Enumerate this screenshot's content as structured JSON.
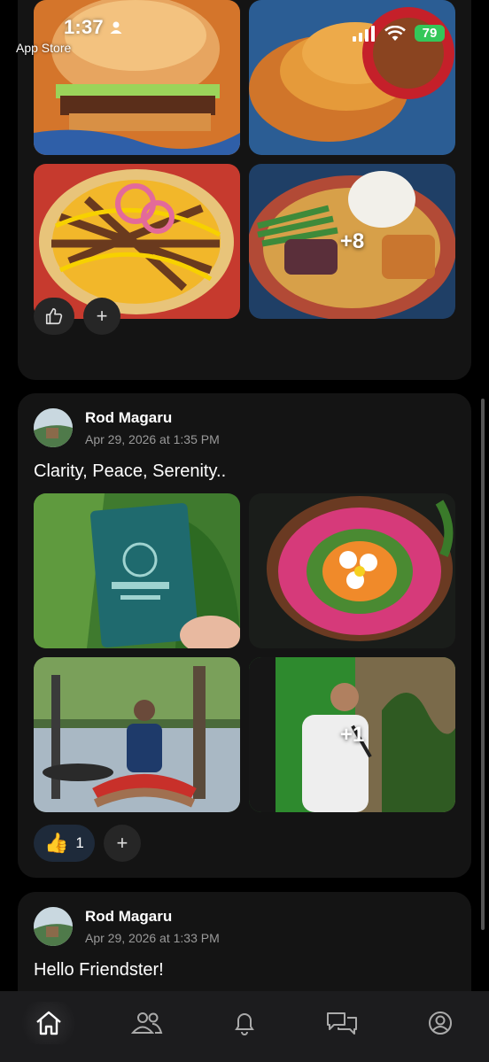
{
  "status_bar": {
    "time": "1:37",
    "back_label": "App Store",
    "battery": "79"
  },
  "posts": [
    {
      "images": [
        {
          "icon": "burger-photo"
        },
        {
          "icon": "crepes-photo"
        },
        {
          "icon": "loaded-fries-photo"
        },
        {
          "icon": "rice-plate-photo",
          "more": "+8"
        }
      ],
      "reactions": {
        "like_icon": "thumbs-up-outline-icon",
        "add_label": "+"
      }
    },
    {
      "author": "Rod Magaru",
      "timestamp": "Apr 29, 2026 at 1:35 PM",
      "text": "Clarity, Peace, Serenity..",
      "images": [
        {
          "icon": "resort-map-photo"
        },
        {
          "icon": "flower-bowl-photo"
        },
        {
          "icon": "yoga-photo"
        },
        {
          "icon": "speaker-photo",
          "more": "+1"
        }
      ],
      "reactions": {
        "emoji": "👍",
        "count": "1",
        "add_label": "+"
      }
    },
    {
      "author": "Rod Magaru",
      "timestamp": "Apr 29, 2026 at 1:33 PM",
      "text": "Hello Friendster!"
    }
  ],
  "tabbar": {
    "items": [
      {
        "icon": "home-icon",
        "active": true
      },
      {
        "icon": "friends-icon"
      },
      {
        "icon": "bell-icon"
      },
      {
        "icon": "chat-icon"
      },
      {
        "icon": "profile-icon"
      }
    ]
  },
  "colors": {
    "background": "#000000",
    "card": "#141414",
    "tabbar": "#1c1c1e",
    "battery": "#34c759"
  }
}
